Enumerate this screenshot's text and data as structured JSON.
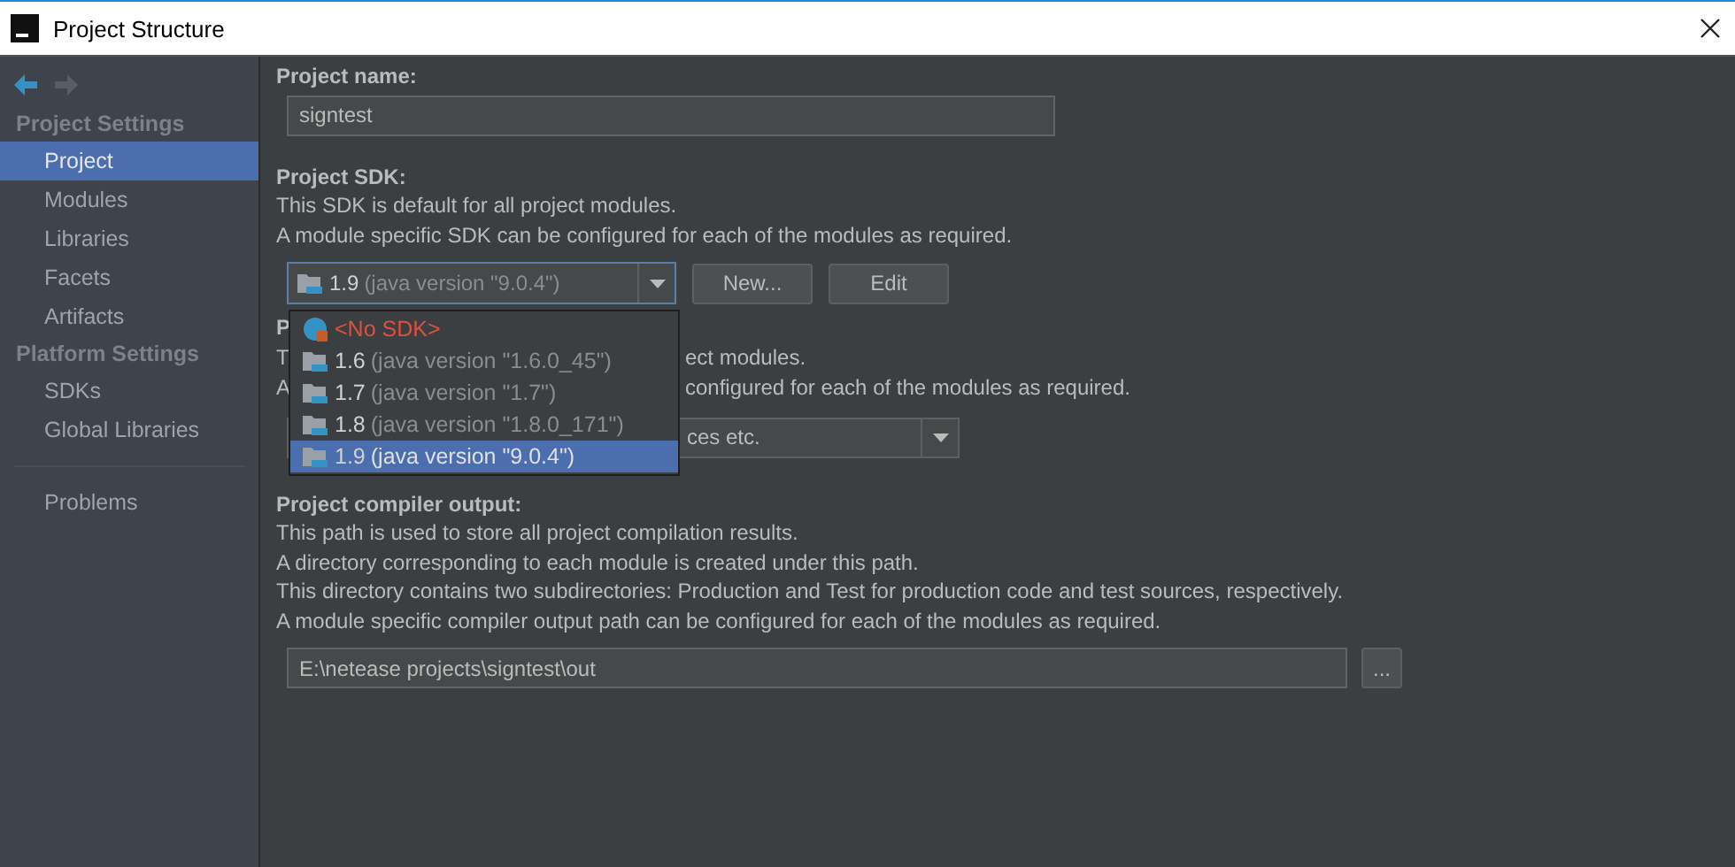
{
  "window": {
    "title": "Project Structure"
  },
  "sidebar": {
    "sections": [
      {
        "title": "Project Settings",
        "items": [
          {
            "label": "Project",
            "selected": true
          },
          {
            "label": "Modules",
            "selected": false
          },
          {
            "label": "Libraries",
            "selected": false
          },
          {
            "label": "Facets",
            "selected": false
          },
          {
            "label": "Artifacts",
            "selected": false
          }
        ]
      },
      {
        "title": "Platform Settings",
        "items": [
          {
            "label": "SDKs",
            "selected": false
          },
          {
            "label": "Global Libraries",
            "selected": false
          }
        ]
      },
      {
        "items": [
          {
            "label": "Problems",
            "selected": false
          }
        ]
      }
    ]
  },
  "project_name": {
    "label": "Project name:",
    "value": "signtest"
  },
  "project_sdk": {
    "label": "Project SDK:",
    "description": [
      "This SDK is default for all project modules.",
      "A module specific SDK can be configured for each of the modules as required."
    ],
    "combo": {
      "version": "1.9",
      "detail": "(java version \"9.0.4\")"
    },
    "buttons": [
      "New...",
      "Edit"
    ],
    "dropdown": {
      "options": [
        {
          "kind": "none",
          "version": "<No SDK>",
          "selected": false
        },
        {
          "kind": "jdk",
          "version": "1.6",
          "detail": "(java version \"1.6.0_45\")",
          "selected": false
        },
        {
          "kind": "jdk",
          "version": "1.7",
          "detail": "(java version \"1.7\")",
          "selected": false
        },
        {
          "kind": "jdk",
          "version": "1.8",
          "detail": "(java version \"1.8.0_171\")",
          "selected": false
        },
        {
          "kind": "jdk",
          "version": "1.9",
          "detail": "(java version \"9.0.4\")",
          "selected": true
        }
      ]
    }
  },
  "language_level": {
    "title_fragment": "P",
    "lines": [
      {
        "start": "T",
        "end": "ect modules."
      },
      {
        "start": "A",
        "end": "configured for each of the modules as required."
      }
    ],
    "combo_fragment": "ces etc."
  },
  "compiler_output": {
    "label": "Project compiler output:",
    "description": [
      "This path is used to store all project compilation results.",
      "A directory corresponding to each module is created under this path.",
      "This directory contains two subdirectories: Production and Test for production code and test sources, respectively.",
      "A module specific compiler output path can be configured for each of the modules as required."
    ],
    "path": "E:\\netease projects\\signtest\\out",
    "browse": "..."
  }
}
